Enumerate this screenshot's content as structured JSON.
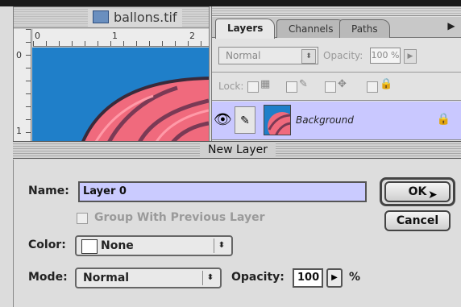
{
  "document": {
    "title": "ballons.tif",
    "ruler_h_labels": [
      "0",
      "1",
      "2"
    ],
    "ruler_v_labels": [
      "0",
      "1"
    ]
  },
  "layers_palette": {
    "tabs": [
      {
        "label": "Layers",
        "active": true
      },
      {
        "label": "Channels",
        "active": false
      },
      {
        "label": "Paths",
        "active": false
      }
    ],
    "blend_mode": "Normal",
    "opacity_label": "Opacity:",
    "opacity_value": "100 %",
    "lock_label": "Lock:",
    "layer": {
      "name": "Background"
    }
  },
  "dialog": {
    "title": "New Layer",
    "name_label": "Name:",
    "name_value": "Layer 0",
    "group_label": "Group With Previous Layer",
    "color_label": "Color:",
    "color_value": "None",
    "mode_label": "Mode:",
    "mode_value": "Normal",
    "opacity_label": "Opacity:",
    "opacity_value": "100",
    "percent": "%",
    "ok_label": "OK",
    "cancel_label": "Cancel"
  },
  "colors": {
    "sky": "#1f7fc9",
    "balloon": "#f06a7d",
    "highlight_field": "#cacbff"
  }
}
